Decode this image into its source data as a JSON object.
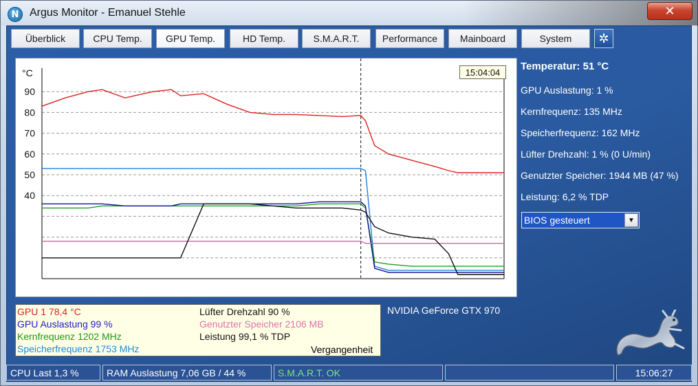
{
  "window": {
    "title": "Argus Monitor - Emanuel Stehle",
    "app_icon_glyph": "N",
    "close_glyph": "✕"
  },
  "tabs": [
    {
      "label": "Überblick",
      "active": false
    },
    {
      "label": "CPU Temp.",
      "active": false
    },
    {
      "label": "GPU Temp.",
      "active": true
    },
    {
      "label": "HD Temp.",
      "active": false
    },
    {
      "label": "S.M.A.R.T.",
      "active": false
    },
    {
      "label": "Performance",
      "active": false
    },
    {
      "label": "Mainboard",
      "active": false
    },
    {
      "label": "System",
      "active": false
    }
  ],
  "settings_icon": "gear-icon",
  "settings_glyph": "✲",
  "chart": {
    "time_label": "15:04:04",
    "unit_label": "°C",
    "tick_labels": [
      "90",
      "80",
      "70",
      "60",
      "50",
      "40"
    ]
  },
  "chart_data": {
    "type": "line",
    "ylabel": "°C",
    "ylim": [
      0,
      100
    ],
    "ticks": [
      90,
      80,
      70,
      60,
      50,
      40
    ],
    "cursor_x": 69,
    "x": [
      0,
      5,
      10,
      13,
      18,
      20,
      24,
      28,
      30,
      35,
      40,
      45,
      50,
      55,
      60,
      65,
      69,
      70,
      72,
      75,
      80,
      85,
      88,
      90,
      93,
      95,
      98,
      100
    ],
    "series": [
      {
        "color": "#e02020",
        "values": [
          83,
          87,
          90,
          91,
          87,
          88,
          90,
          91,
          88,
          89,
          84,
          80,
          79,
          79,
          78.5,
          78,
          78.5,
          76,
          64,
          60,
          57,
          54,
          52,
          51,
          51,
          51,
          51,
          51
        ]
      },
      {
        "color": "#2080e0",
        "values": [
          53,
          53,
          53,
          53,
          53,
          53,
          53,
          53,
          53,
          53,
          53,
          53,
          53,
          53,
          53,
          53,
          53,
          52,
          6,
          4,
          4,
          4,
          4,
          4,
          4,
          4,
          4,
          4
        ]
      },
      {
        "color": "#20a020",
        "values": [
          34,
          34,
          34,
          35,
          35,
          35,
          35,
          35,
          35,
          35,
          35,
          35,
          35,
          35,
          36,
          36,
          36,
          34,
          8,
          7,
          6,
          6,
          6,
          6,
          6,
          6,
          6,
          6
        ]
      },
      {
        "color": "#101090",
        "values": [
          36,
          36,
          36,
          36,
          35,
          35,
          35,
          35,
          36,
          36,
          36,
          36,
          36,
          36,
          37,
          37,
          37,
          35,
          5,
          3,
          3,
          3,
          3,
          3,
          3,
          3,
          3,
          3
        ]
      },
      {
        "color": "#e060a0",
        "values": [
          18,
          18,
          18,
          18,
          18,
          18,
          18,
          18,
          18,
          18,
          18,
          18,
          18,
          18,
          18,
          18,
          18,
          17,
          17,
          17,
          17,
          17,
          17,
          17,
          17,
          17,
          17,
          17
        ]
      },
      {
        "color": "#111111",
        "values": [
          10,
          10,
          10,
          10,
          10,
          10,
          10,
          10,
          10,
          36,
          36,
          36,
          35,
          34,
          34,
          34,
          33,
          32,
          25,
          22,
          20,
          19,
          12,
          2,
          2,
          2,
          2,
          2
        ]
      }
    ]
  },
  "info": {
    "temperature": "Temperatur: 51 °C",
    "gpu_load": "GPU Auslastung: 1 %",
    "core_freq": "Kernfrequenz: 135 MHz",
    "mem_freq": "Speicherfrequenz: 162 MHz",
    "fan_speed": "Lüfter Drehzahl: 1 % (0 U/min)",
    "used_mem": "Genutzter Speicher: 1944 MB (47 %)",
    "power": "Leistung: 6,2 % TDP",
    "fan_mode": "BIOS gesteuert"
  },
  "legend": {
    "gpu1": {
      "text": "GPU 1  78,4 °C",
      "color": "#e02020"
    },
    "gpu_load": {
      "text": "GPU Auslastung  99 %",
      "color": "#1a1ac8"
    },
    "core_freq": {
      "text": "Kernfrequenz  1202 MHz",
      "color": "#1a9a1a"
    },
    "mem_freq": {
      "text": "Speicherfrequenz  1753 MHz",
      "color": "#1a8ad8"
    },
    "fan": {
      "text": "Lüfter Drehzahl  90 %",
      "color": "#111111"
    },
    "used_mem": {
      "text": "Genutzter Speicher  2106 MB",
      "color": "#e070a8"
    },
    "power": {
      "text": "Leistung  99,1 % TDP",
      "color": "#111111"
    },
    "history": "Vergangenheit"
  },
  "gpu_name": "NVIDIA GeForce GTX 970",
  "status": {
    "cpu": "CPU Last 1,3 %",
    "ram": "RAM Auslastung 7,06 GB / 44 %",
    "smart": "S.M.A.R.T. OK",
    "empty": "",
    "time": "15:06:27"
  }
}
